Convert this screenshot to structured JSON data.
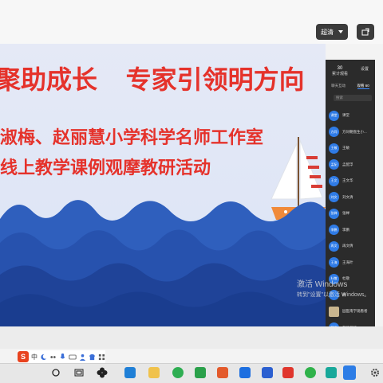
{
  "toolbar": {
    "quality_label": "超清"
  },
  "slide": {
    "title": "聚助成长    专家引领明方向",
    "line1": "淑梅、赵丽慧小学科学名师工作室",
    "line2": "线上教学课例观摩教研活动"
  },
  "panel": {
    "stats": [
      {
        "num": "30",
        "label": "累计观看"
      },
      {
        "num": "",
        "label": "设置"
      }
    ],
    "tabs": [
      "聊天互动",
      "观看 60"
    ],
    "search_placeholder": "搜索",
    "users": [
      {
        "avatar": "课堂",
        "name": "课堂"
      },
      {
        "avatar": "方同",
        "name": "方同朝盘生小..."
      },
      {
        "avatar": "王敏",
        "name": "王敏"
      },
      {
        "avatar": "孟配",
        "name": "孟配浮"
      },
      {
        "avatar": "王文",
        "name": "王文华"
      },
      {
        "avatar": "刘文",
        "name": "刘文清"
      },
      {
        "avatar": "张婵",
        "name": "张婵"
      },
      {
        "avatar": "李鹏",
        "name": "李鹏"
      },
      {
        "avatar": "再文",
        "name": "再文倩"
      },
      {
        "avatar": "王海",
        "name": "王海叶"
      },
      {
        "avatar": "杜敬",
        "name": "杜敬"
      },
      {
        "avatar": "",
        "name": "周"
      },
      {
        "avatar": "",
        "name": "园医南学观看者"
      },
      {
        "avatar": "英语",
        "name": "英语老师"
      }
    ]
  },
  "watermark": {
    "line1": "激活 Windows",
    "line2": "转到\"设置\"以激活 Windows。"
  },
  "ime": {
    "logo": "S",
    "lang": "中"
  },
  "colors": {
    "title_red": "#e5322b",
    "wave_dark": "#1a3d8f",
    "wave_mid": "#2f5fbd",
    "avatar_blue": "#2f7be6"
  }
}
